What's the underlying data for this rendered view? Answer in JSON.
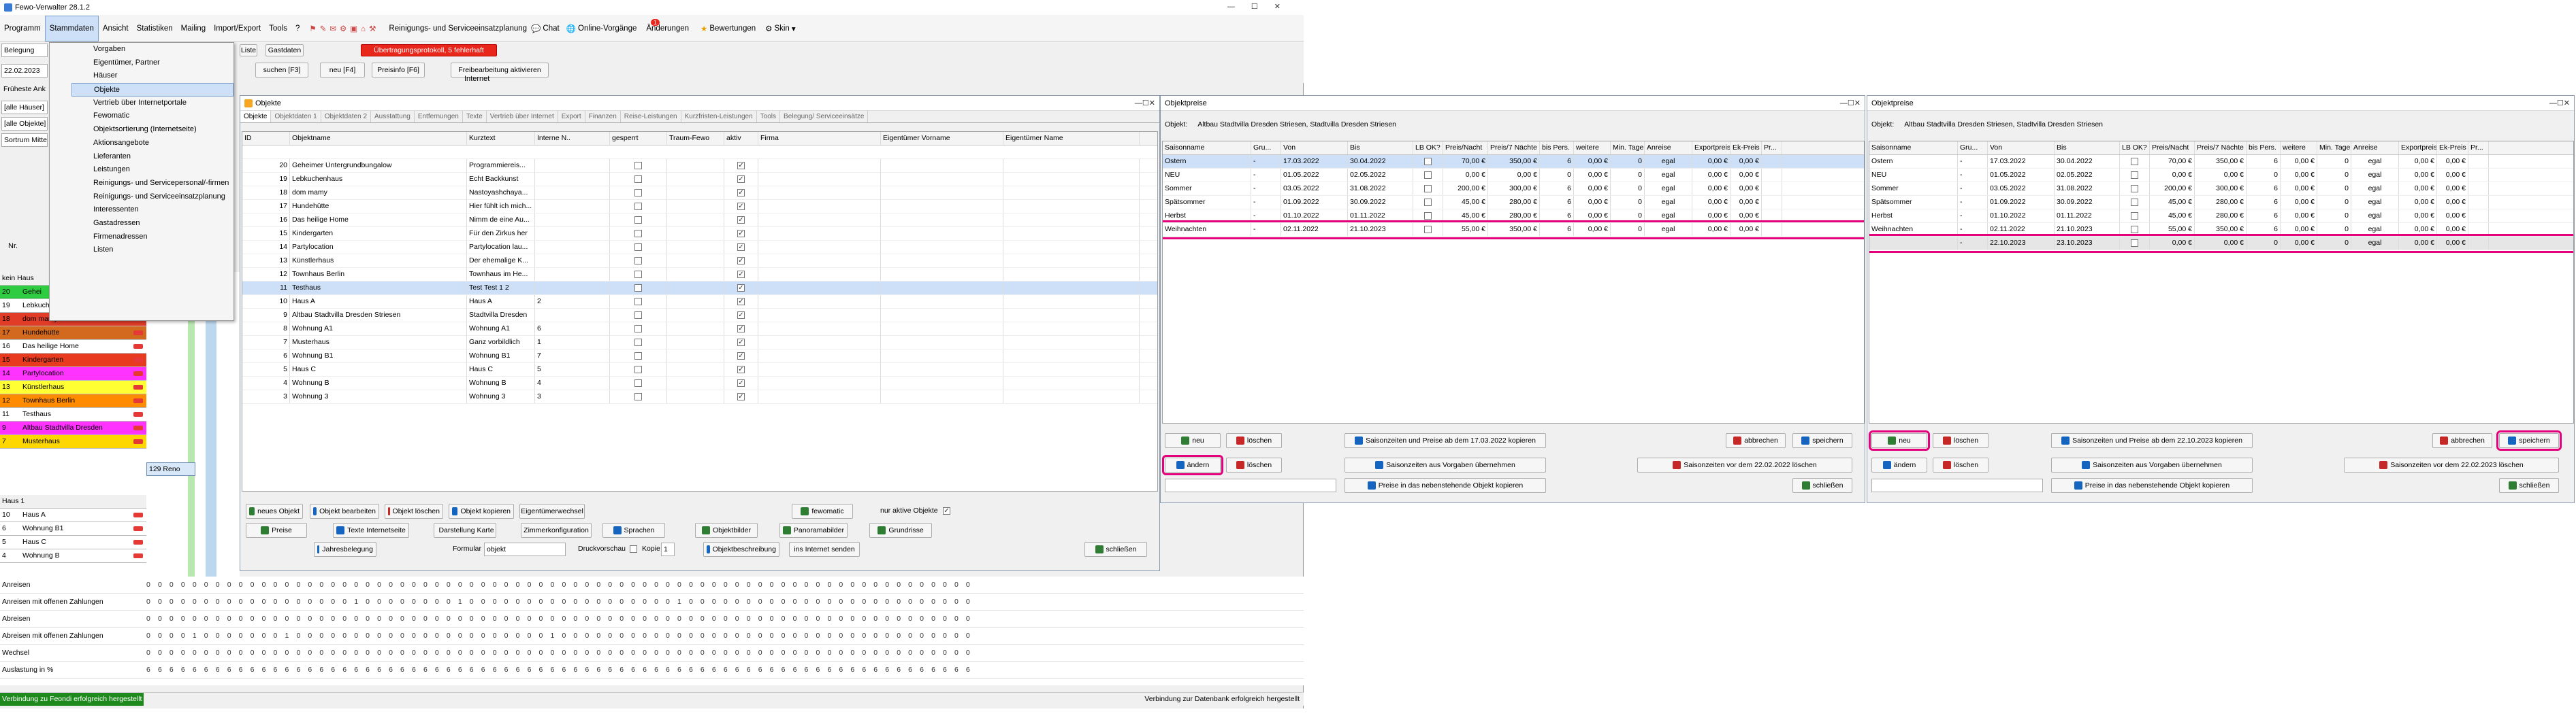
{
  "app": {
    "title": "Fewo-Verwalter 28.1.2"
  },
  "menubar": [
    "Programm",
    "Stammdaten",
    "Ansicht",
    "Statistiken",
    "Mailing",
    "Import/Export",
    "Tools",
    "?"
  ],
  "toolbar": {
    "reinigung": "Reinigungs- und Serviceeinsatzplanung",
    "chat": "Chat",
    "online": "Online-Vorgänge",
    "aenderungen": "Änderungen",
    "badge": "1",
    "bewertungen": "Bewertungen",
    "skin": "Skin"
  },
  "stammdaten_menu": [
    "Vorgaben",
    "Eigentümer, Partner",
    "Häuser",
    "Objekte",
    "Vertrieb über Internetportale",
    "Fewomatic",
    "Objektsortierung (Internetseite)",
    "Aktionsangebote",
    "Lieferanten",
    "Leistungen",
    "Reinigungs- und Servicepersonal/-firmen",
    "Reinigungs- und Serviceeinsatzplanung",
    "Interessenten",
    "Gastadressen",
    "Firmenadressen",
    "Listen"
  ],
  "topstrip": {
    "liste": "Liste",
    "gastdaten": "Gastdaten",
    "warn": "Übertragungsprotokoll, 5 fehlerhaft",
    "suchen": "suchen [F3]",
    "neu": "neu [F4]",
    "preisinfo": "Preisinfo [F6]",
    "freibearbeitung": "Freibearbeitung aktivieren",
    "internet": "Internet"
  },
  "left": {
    "belegung": "Belegung",
    "date": "22.02.2023",
    "frueheste": "Früheste Ank",
    "alle_haeuser": "[alle Häuser]",
    "alle_objekte": "[alle Objekte]",
    "sortierung": "Sortrum Mitte",
    "nr": "Nr.",
    "kein_haus": "kein Haus",
    "haus1": "Haus 1",
    "popup": "129 Reno",
    "rows": [
      {
        "nr": "20",
        "name": "Gehei",
        "color": "#2ecc40"
      },
      {
        "nr": "19",
        "name": "Lebkuchenhaus",
        "color": "#ffffff"
      },
      {
        "nr": "18",
        "name": "dom mamy",
        "color": "#e03c28"
      },
      {
        "nr": "17",
        "name": "Hundehütte",
        "color": "#d2691e"
      },
      {
        "nr": "16",
        "name": "Das heilige Home",
        "color": "#ffffff"
      },
      {
        "nr": "15",
        "name": "Kindergarten",
        "color": "#e83a1e"
      },
      {
        "nr": "14",
        "name": "Partylocation",
        "color": "#ff33ff"
      },
      {
        "nr": "13",
        "name": "Künstlerhaus",
        "color": "#ffff33"
      },
      {
        "nr": "12",
        "name": "Townhaus Berlin",
        "color": "#ff8c00"
      },
      {
        "nr": "11",
        "name": "Testhaus",
        "color": "#ffffff"
      },
      {
        "nr": "9",
        "name": "Altbau Stadtvilla Dresden",
        "color": "#ff33ff"
      },
      {
        "nr": "7",
        "name": "Musterhaus",
        "color": "#ffd700"
      }
    ],
    "rows2": [
      {
        "nr": "10",
        "name": "Haus A"
      },
      {
        "nr": "6",
        "name": "Wohnung B1"
      },
      {
        "nr": "5",
        "name": "Haus C"
      },
      {
        "nr": "4",
        "name": "Wohnung B"
      }
    ]
  },
  "summary": [
    {
      "label": "Anreisen",
      "vals": "0 0 0 0 0 0 0 0 0 0 0 0 0 0 0 0 0 0 0 0 0 0 0 0 0 0 0 0 0 0 0 0 0 0 0 0 0 0 0 0 0 0 0 0 0 0 0 0 0 0 0 0 0 0 0 0 0 0 0 0 0 0 0 0 0 0 0 0 0 0 0 0"
    },
    {
      "label": "Anreisen mit offenen Zahlungen",
      "vals": "0 0 0 0 0 0 0 0 0 0 0 0 0 0 0 0 0 0 1 0 0 0 0 0 0 0 0 1 0 0 0 0 0 0 0 0 0 0 0 0 0 0 0 0 0 0 1 0 0 0 0 0 0 0 0 0 0 0 0 0 0 0 0 0 0 0 0 0 0 0 0 0"
    },
    {
      "label": "Abreisen",
      "vals": "0 0 0 0 0 0 0 0 0 0 0 0 0 0 0 0 0 0 0 0 0 0 0 0 0 0 0 0 0 0 0 0 0 0 0 0 0 0 0 0 0 0 0 0 0 0 0 0 0 0 0 0 0 0 0 0 0 0 0 0 0 0 0 0 0 0 0 0 0 0 0 0"
    },
    {
      "label": "Abreisen mit offenen Zahlungen",
      "vals": "0 0 0 0 1 0 0 0 0 0 0 0 1 0 0 0 0 0 0 0 0 0 0 0 0 0 0 0 0 0 0 0 0 0 0 1 0 0 0 0 0 0 0 0 0 0 0 0 0 0 0 0 0 0 0 0 0 0 0 0 0 0 0 0 0 0 0 0 0 0 0 0"
    },
    {
      "label": "Wechsel",
      "vals": "0 0 0 0 0 0 0 0 0 0 0 0 0 0 0 0 0 0 0 0 0 0 0 0 0 0 0 0 0 0 0 0 0 0 0 0 0 0 0 0 0 0 0 0 0 0 0 0 0 0 0 0 0 0 0 0 0 0 0 0 0 0 0 0 0 0 0 0 0 0 0 0"
    },
    {
      "label": "Auslastung in %",
      "vals": "6 6 6 6 6 6 6 6 6 6 6 6 6 6 6 6 6 6 6 6 6 6 6 6 6 6 6 6 6 6 6 6 6 6 6 6 6 6 6 6 6 6 6 6 6 6 6 6 6 6 6 6 6 6 6 6 6 6 6 6 6 6 6 6 6 6 6 6 6 6 6 6"
    }
  ],
  "statusbar": {
    "left": "Verbindung zu Feondi erfolgreich hergestellt",
    "right": "Verbindung zur Datenbank erfolgreich hergestellt"
  },
  "objekte": {
    "title": "Objekte",
    "tabs": [
      "Objekte",
      "Objektdaten 1",
      "Objektdaten 2",
      "Ausstattung",
      "Entfernungen",
      "Texte",
      "Vertrieb über Internet",
      "Export",
      "Finanzen",
      "Reise-Leistungen",
      "Kurzfristen-Leistungen",
      "Tools",
      "Belegung/ Serviceeinsätze"
    ],
    "columns": [
      "ID",
      "Objektname",
      "Kurztext",
      "Interne N..",
      "gesperrt",
      "Traum-Fewo",
      "aktiv",
      "Firma",
      "Eigentümer Vorname",
      "Eigentümer Name"
    ],
    "rows": [
      {
        "id": "20",
        "name": "Geheimer Untergrundbungalow",
        "kurz": "Programmiereis...",
        "int": "",
        "gesp": false,
        "akt": true
      },
      {
        "id": "19",
        "name": "Lebkuchenhaus",
        "kurz": "Echt Backkunst",
        "int": "",
        "gesp": false,
        "akt": true
      },
      {
        "id": "18",
        "name": "dom mamy",
        "kurz": "Nastoyashchaya...",
        "int": "",
        "gesp": false,
        "akt": true
      },
      {
        "id": "17",
        "name": "Hundehütte",
        "kurz": "Hier fühlt ich mich...",
        "int": "",
        "gesp": false,
        "akt": true
      },
      {
        "id": "16",
        "name": "Das heilige Home",
        "kurz": "Nimm de eine Au...",
        "int": "",
        "gesp": false,
        "akt": true
      },
      {
        "id": "15",
        "name": "Kindergarten",
        "kurz": "Für den Zirkus her",
        "int": "",
        "gesp": false,
        "akt": true
      },
      {
        "id": "14",
        "name": "Partylocation",
        "kurz": "Partylocation lau...",
        "int": "",
        "gesp": false,
        "akt": true
      },
      {
        "id": "13",
        "name": "Künstlerhaus",
        "kurz": "Der ehemalige K...",
        "int": "",
        "gesp": false,
        "akt": true
      },
      {
        "id": "12",
        "name": "Townhaus Berlin",
        "kurz": "Townhaus im He...",
        "int": "",
        "gesp": false,
        "akt": true
      },
      {
        "id": "11",
        "name": "Testhaus",
        "kurz": "Test Test 1 2",
        "int": "",
        "gesp": false,
        "akt": true,
        "sel": true
      },
      {
        "id": "10",
        "name": "Haus A",
        "kurz": "Haus A",
        "int": "2",
        "gesp": false,
        "akt": true
      },
      {
        "id": "9",
        "name": "Altbau Stadtvilla Dresden Striesen",
        "kurz": "Stadtvilla Dresden",
        "int": "",
        "gesp": false,
        "akt": true
      },
      {
        "id": "8",
        "name": "Wohnung A1",
        "kurz": "Wohnung A1",
        "int": "6",
        "gesp": false,
        "akt": true
      },
      {
        "id": "7",
        "name": "Musterhaus",
        "kurz": "Ganz vorbildlich",
        "int": "1",
        "gesp": false,
        "akt": true
      },
      {
        "id": "6",
        "name": "Wohnung B1",
        "kurz": "Wohnung B1",
        "int": "7",
        "gesp": false,
        "akt": true
      },
      {
        "id": "5",
        "name": "Haus C",
        "kurz": "Haus C",
        "int": "5",
        "gesp": false,
        "akt": true
      },
      {
        "id": "4",
        "name": "Wohnung B",
        "kurz": "Wohnung B",
        "int": "4",
        "gesp": false,
        "akt": true
      },
      {
        "id": "3",
        "name": "Wohnung 3",
        "kurz": "Wohnung 3",
        "int": "3",
        "gesp": false,
        "akt": true
      }
    ],
    "btn": {
      "neues": "neues Objekt",
      "bearbeiten": "Objekt bearbeiten",
      "loeschen": "Objekt löschen",
      "kopieren": "Objekt kopieren",
      "eigentuemer": "Eigentümerwechsel",
      "fewomatic": "fewomatic",
      "nur_aktive": "nur aktive Objekte",
      "preise": "Preise",
      "texte": "Texte Internetseite",
      "karte": "Darstellung Karte",
      "zimmer": "Zimmerkonfiguration",
      "sprachen": "Sprachen",
      "bilder": "Objektbilder",
      "panorama": "Panoramabilder",
      "grundrisse": "Grundrisse",
      "jahres": "Jahresbelegung",
      "formular": "Formular",
      "formular_val": "objekt",
      "druckvorschau": "Druckvorschau",
      "kopie": "Kopie",
      "kopie_val": "1",
      "beschreibung": "Objektbeschreibung",
      "internet": "ins Internet senden",
      "schliessen": "schließen"
    }
  },
  "preise_left": {
    "title": "Objektpreise",
    "objekt_label": "Objekt:",
    "objekt": "Altbau Stadtvilla Dresden Striesen, Stadtvilla Dresden Striesen",
    "columns": [
      "Saisonname",
      "Gru...",
      "Von",
      "Bis",
      "LB OK?",
      "Preis/Nacht",
      "Preis/7 Nächte",
      "bis Pers.",
      "weitere",
      "Min. Tage",
      "Anreise",
      "Exportpreis",
      "Ek-Preis",
      "Pr..."
    ],
    "rows": [
      {
        "name": "Ostern",
        "gru": "-",
        "von": "17.03.2022",
        "bis": "30.04.2022",
        "p1": "70,00 €",
        "p7": "350,00 €",
        "pers": "6",
        "weit": "0,00 €",
        "min": "0",
        "anr": "egal",
        "exp": "0,00 €",
        "ek": "0,00 €",
        "sel": true
      },
      {
        "name": "NEU",
        "gru": "-",
        "von": "01.05.2022",
        "bis": "02.05.2022",
        "p1": "0,00 €",
        "p7": "0,00 €",
        "pers": "0",
        "weit": "0,00 €",
        "min": "0",
        "anr": "egal",
        "exp": "0,00 €",
        "ek": "0,00 €"
      },
      {
        "name": "Sommer",
        "gru": "-",
        "von": "03.05.2022",
        "bis": "31.08.2022",
        "p1": "200,00 €",
        "p7": "300,00 €",
        "pers": "6",
        "weit": "0,00 €",
        "min": "0",
        "anr": "egal",
        "exp": "0,00 €",
        "ek": "0,00 €"
      },
      {
        "name": "Spätsommer",
        "gru": "-",
        "von": "01.09.2022",
        "bis": "30.09.2022",
        "p1": "45,00 €",
        "p7": "280,00 €",
        "pers": "6",
        "weit": "0,00 €",
        "min": "0",
        "anr": "egal",
        "exp": "0,00 €",
        "ek": "0,00 €"
      },
      {
        "name": "Herbst",
        "gru": "-",
        "von": "01.10.2022",
        "bis": "01.11.2022",
        "p1": "45,00 €",
        "p7": "280,00 €",
        "pers": "6",
        "weit": "0,00 €",
        "min": "0",
        "anr": "egal",
        "exp": "0,00 €",
        "ek": "0,00 €"
      },
      {
        "name": "Weihnachten",
        "gru": "-",
        "von": "02.11.2022",
        "bis": "21.10.2023",
        "p1": "55,00 €",
        "p7": "350,00 €",
        "pers": "6",
        "weit": "0,00 €",
        "min": "0",
        "anr": "egal",
        "exp": "0,00 €",
        "ek": "0,00 €",
        "hl": true
      }
    ],
    "btn": {
      "neu": "neu",
      "loeschen": "löschen",
      "kopieren": "Saisonzeiten und Preise ab dem 17.03.2022 kopieren",
      "abbrechen": "abbrechen",
      "speichern": "speichern",
      "aendern": "ändern",
      "loeschen2": "löschen",
      "vorgaben": "Saisonzeiten aus Vorgaben übernehmen",
      "vordem": "Saisonzeiten vor dem 22.02.2022 löschen",
      "preise_kopieren": "Preise in das nebenstehende Objekt kopieren",
      "schliessen": "schließen"
    }
  },
  "preise_right": {
    "title": "Objektpreise",
    "objekt_label": "Objekt:",
    "objekt": "Altbau Stadtvilla Dresden Striesen, Stadtvilla Dresden Striesen",
    "rows": [
      {
        "name": "Ostern",
        "gru": "-",
        "von": "17.03.2022",
        "bis": "30.04.2022",
        "p1": "70,00 €",
        "p7": "350,00 €",
        "pers": "6",
        "weit": "0,00 €",
        "min": "0",
        "anr": "egal",
        "exp": "0,00 €",
        "ek": "0,00 €"
      },
      {
        "name": "NEU",
        "gru": "-",
        "von": "01.05.2022",
        "bis": "02.05.2022",
        "p1": "0,00 €",
        "p7": "0,00 €",
        "pers": "0",
        "weit": "0,00 €",
        "min": "0",
        "anr": "egal",
        "exp": "0,00 €",
        "ek": "0,00 €"
      },
      {
        "name": "Sommer",
        "gru": "-",
        "von": "03.05.2022",
        "bis": "31.08.2022",
        "p1": "200,00 €",
        "p7": "300,00 €",
        "pers": "6",
        "weit": "0,00 €",
        "min": "0",
        "anr": "egal",
        "exp": "0,00 €",
        "ek": "0,00 €"
      },
      {
        "name": "Spätsommer",
        "gru": "-",
        "von": "01.09.2022",
        "bis": "30.09.2022",
        "p1": "45,00 €",
        "p7": "280,00 €",
        "pers": "6",
        "weit": "0,00 €",
        "min": "0",
        "anr": "egal",
        "exp": "0,00 €",
        "ek": "0,00 €"
      },
      {
        "name": "Herbst",
        "gru": "-",
        "von": "01.10.2022",
        "bis": "01.11.2022",
        "p1": "45,00 €",
        "p7": "280,00 €",
        "pers": "6",
        "weit": "0,00 €",
        "min": "0",
        "anr": "egal",
        "exp": "0,00 €",
        "ek": "0,00 €"
      },
      {
        "name": "Weihnachten",
        "gru": "-",
        "von": "02.11.2022",
        "bis": "21.10.2023",
        "p1": "55,00 €",
        "p7": "350,00 €",
        "pers": "6",
        "weit": "0,00 €",
        "min": "0",
        "anr": "egal",
        "exp": "0,00 €",
        "ek": "0,00 €"
      },
      {
        "name": "",
        "gru": "-",
        "von": "22.10.2023",
        "bis": "23.10.2023",
        "p1": "0,00 €",
        "p7": "0,00 €",
        "pers": "0",
        "weit": "0,00 €",
        "min": "0",
        "anr": "egal",
        "exp": "0,00 €",
        "ek": "0,00 €",
        "hl": true,
        "new": true
      }
    ],
    "btn": {
      "neu": "neu",
      "loeschen": "löschen",
      "kopieren": "Saisonzeiten und Preise ab dem 22.10.2023 kopieren",
      "abbrechen": "abbrechen",
      "speichern": "speichern",
      "aendern": "ändern",
      "loeschen2": "löschen",
      "vorgaben": "Saisonzeiten aus Vorgaben übernehmen",
      "vordem": "Saisonzeiten vor dem 22.02.2023 löschen",
      "preise_kopieren": "Preise in das nebenstehende Objekt kopieren",
      "schliessen": "schließen"
    }
  },
  "colors": {
    "accent": "#e4007c",
    "selection": "#cde0f7",
    "warn": "#e8261c"
  }
}
